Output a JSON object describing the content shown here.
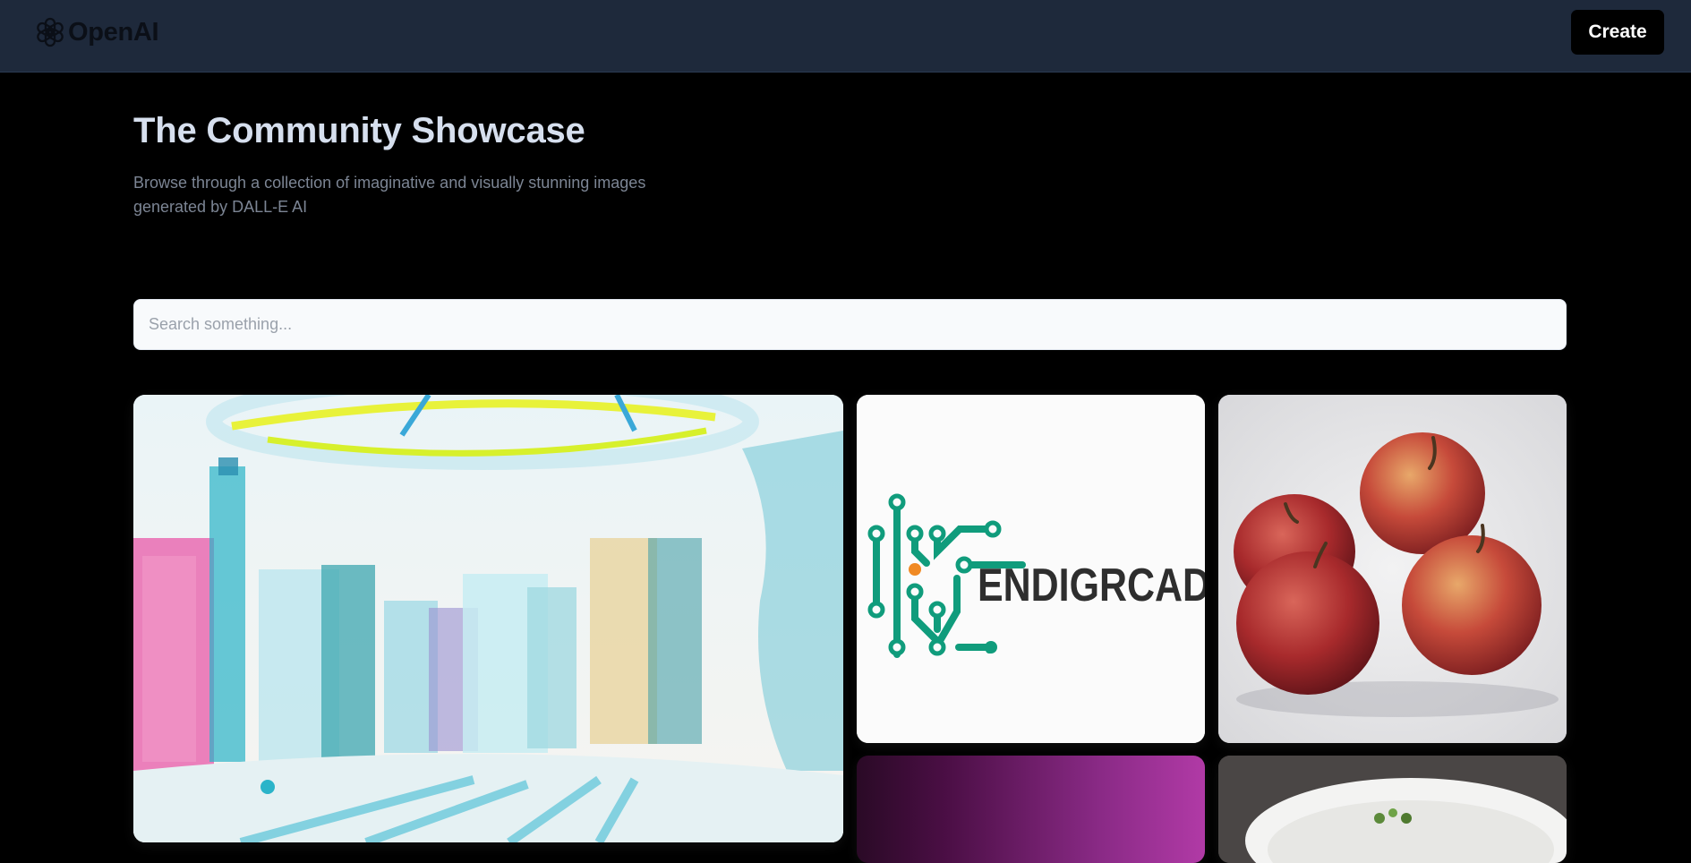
{
  "header": {
    "brand_name": "OpenAI",
    "logo_icon": "openai-logo-icon",
    "create_label": "Create"
  },
  "hero": {
    "title": "The Community Showcase",
    "subtitle": "Browse through a collection of imaginative and visually stunning images generated by DALL-E AI"
  },
  "search": {
    "placeholder": "Search something..."
  },
  "gallery": {
    "cards": [
      {
        "depicts": "watercolor city skyline"
      },
      {
        "depicts": "circuit logo",
        "logo_text": "ENDIGRCAD"
      },
      {
        "depicts": "four red apples"
      },
      {
        "depicts": "purple gradient"
      },
      {
        "depicts": "salad bowl"
      }
    ]
  },
  "colors": {
    "page_background": "#000000",
    "header_background": "#1e293b",
    "headline": "#d6dfee",
    "subtitle": "#7c8594",
    "logo_green": "#109c7c"
  }
}
